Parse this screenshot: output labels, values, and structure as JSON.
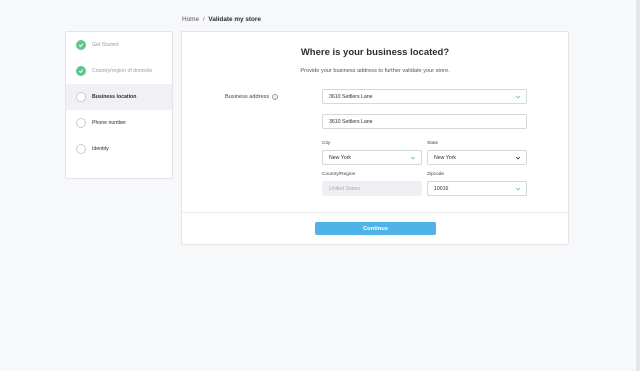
{
  "breadcrumb": {
    "home": "Home",
    "separator": "/",
    "current": "Validate my store"
  },
  "steps": [
    {
      "label": "Get Started",
      "state": "done"
    },
    {
      "label": "Country/region of domicile",
      "state": "done"
    },
    {
      "label": "Business location",
      "state": "active"
    },
    {
      "label": "Phone number",
      "state": "pending"
    },
    {
      "label": "Identity",
      "state": "pending"
    }
  ],
  "form": {
    "title": "Where is your business located?",
    "subtitle": "Provide your business address to further validate your store.",
    "business_address_label": "Business address",
    "info_glyph": "?",
    "address_select_value": "3610 Settlers Lane",
    "address_line_value": "3610 Settlers Lane",
    "city_label": "City",
    "city_value": "New York",
    "state_label": "State",
    "state_value": "New York",
    "country_label": "Country/Region",
    "country_value": "United States",
    "zip_label": "Zipcode",
    "zip_value": "10016",
    "continue_label": "Continue"
  },
  "colors": {
    "accent": "#4fb3e8",
    "check_green": "#5fc88f",
    "valid_chevron": "#5fc88f"
  },
  "icons": {
    "done": "check-icon",
    "valid": "chevron-down-icon",
    "dropdown": "chevron-down-icon",
    "info": "info-icon"
  }
}
